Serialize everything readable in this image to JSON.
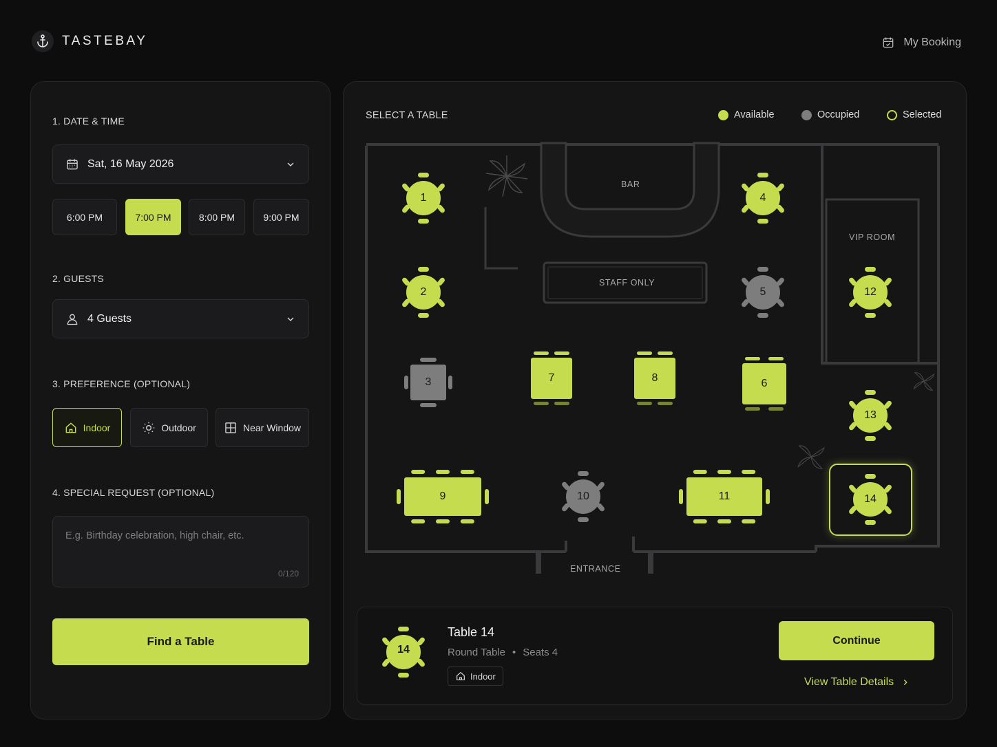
{
  "brand": {
    "name": "TASTEBAY"
  },
  "header": {
    "booking_label": "My Booking"
  },
  "colors": {
    "accent": "#c6dc4f",
    "occupied": "#7d7d7d",
    "panel": "#151516"
  },
  "left": {
    "date_title": "1. DATE & TIME",
    "date_value": "Sat, 16 May 2026",
    "times": [
      "6:00 PM",
      "7:00 PM",
      "8:00 PM",
      "9:00 PM"
    ],
    "selected_time": "7:00 PM",
    "guests_title": "2. GUESTS",
    "guests_value": "4 Guests",
    "pref_title": "3. PREFERENCE (OPTIONAL)",
    "prefs": [
      "Indoor",
      "Outdoor",
      "Near Window"
    ],
    "selected_pref": "Indoor",
    "request_title": "4. SPECIAL REQUEST (OPTIONAL)",
    "request_placeholder": "E.g. Birthday celebration, high chair, etc.",
    "request_counter": "0/120",
    "find_button": "Find a Table"
  },
  "map": {
    "title": "SELECT A TABLE",
    "legend": {
      "available": "Available",
      "occupied": "Occupied",
      "selected": "Selected"
    },
    "labels": {
      "bar": "BAR",
      "staff": "STAFF ONLY",
      "vip": "VIP ROOM",
      "entrance": "ENTRANCE"
    },
    "tables": [
      {
        "id": "1",
        "shape": "round",
        "status": "available"
      },
      {
        "id": "2",
        "shape": "round",
        "status": "available"
      },
      {
        "id": "3",
        "shape": "square",
        "status": "occupied"
      },
      {
        "id": "4",
        "shape": "round",
        "status": "available"
      },
      {
        "id": "5",
        "shape": "round",
        "status": "occupied"
      },
      {
        "id": "6",
        "shape": "square",
        "status": "available"
      },
      {
        "id": "7",
        "shape": "square",
        "status": "available"
      },
      {
        "id": "8",
        "shape": "square",
        "status": "available"
      },
      {
        "id": "9",
        "shape": "long",
        "status": "available"
      },
      {
        "id": "10",
        "shape": "round",
        "status": "occupied"
      },
      {
        "id": "11",
        "shape": "long",
        "status": "available"
      },
      {
        "id": "12",
        "shape": "round",
        "status": "available"
      },
      {
        "id": "13",
        "shape": "round",
        "status": "available"
      },
      {
        "id": "14",
        "shape": "round",
        "status": "selected"
      }
    ]
  },
  "summary": {
    "table_number": "14",
    "title": "Table 14",
    "type": "Round Table",
    "seats": "Seats 4",
    "badge": "Indoor",
    "continue": "Continue",
    "details_link": "View Table Details"
  }
}
